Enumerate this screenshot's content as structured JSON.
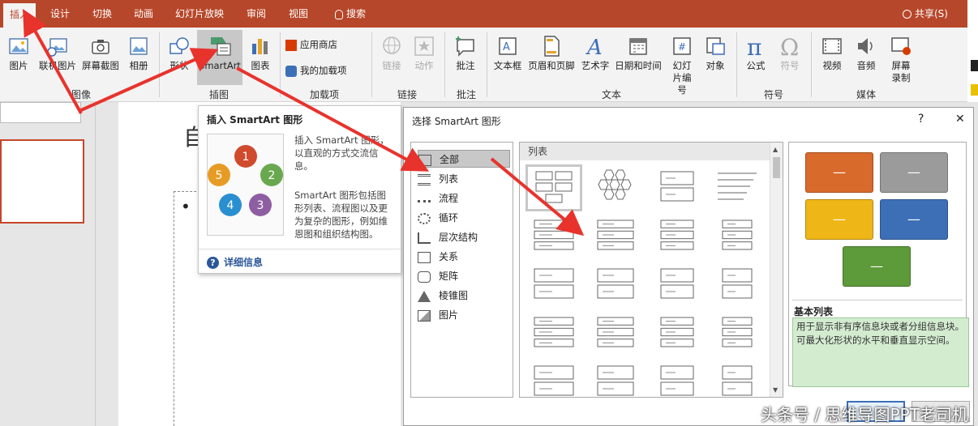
{
  "tabs": [
    "插入",
    "设计",
    "切换",
    "动画",
    "幻灯片放映",
    "审阅",
    "视图"
  ],
  "search_label": "搜索",
  "share_label": "共享(S)",
  "ribbon": {
    "buttons": [
      "图片",
      "联机图片",
      "屏幕截图",
      "相册",
      "形状",
      "SmartArt",
      "图表",
      "应用商店",
      "我的加载项",
      "链接",
      "动作",
      "批注",
      "文本框",
      "页眉和页脚",
      "艺术字",
      "日期和时间",
      "幻灯片编号",
      "对象",
      "公式",
      "符号",
      "视频",
      "音频",
      "屏幕录制"
    ],
    "groups": [
      "图像",
      "插图",
      "加载项",
      "链接",
      "批注",
      "文本",
      "符号",
      "媒体"
    ]
  },
  "tooltip": {
    "title": "插入 SmartArt 图形",
    "desc1": "插入 SmartArt 图形，以直观的方式交流信息。",
    "desc2": "SmartArt 图形包括图形列表、流程图以及更为复杂的图形，例如维恩图和组织结构图。",
    "more": "详细信息",
    "cycle": [
      "1",
      "2",
      "3",
      "4",
      "5"
    ]
  },
  "dialog": {
    "title": "选择 SmartArt 图形",
    "help": "?",
    "close": "✕",
    "categories": [
      "全部",
      "列表",
      "流程",
      "循环",
      "层次结构",
      "关系",
      "矩阵",
      "棱锥图",
      "图片"
    ],
    "section_header": "列表",
    "preview_name": "基本列表",
    "preview_desc": "用于显示非有序信息块或者分组信息块。可最大化形状的水平和垂直显示空间。",
    "swatch_dash": "—",
    "colors": [
      "#d86a2b",
      "#9b9b9b",
      "#efb617",
      "#3d6fb6",
      "#5d9a3a"
    ]
  },
  "slide": {
    "partial_title": "自",
    "bullet": "•"
  },
  "watermark": "头条号 / 思维导图PPT老司机",
  "colors": {
    "accent": "#b7472a",
    "arrow": "#e8332d"
  }
}
